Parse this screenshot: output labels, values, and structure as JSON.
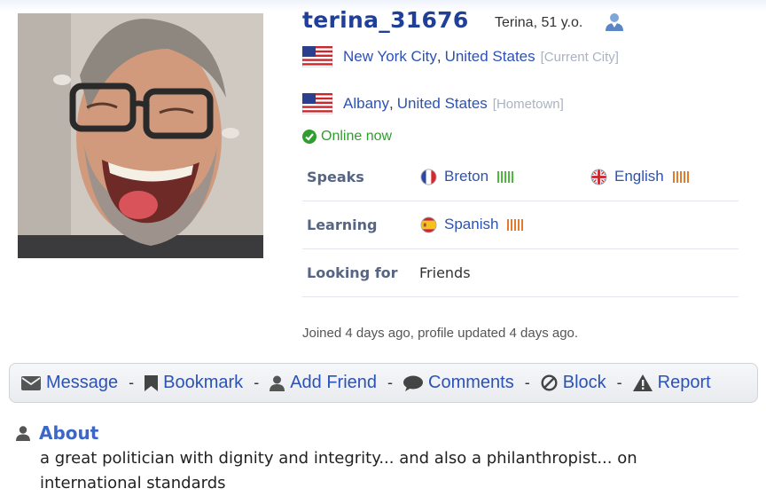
{
  "profile": {
    "username": "terina_31676",
    "age_text": "Terina, 51 y.o.",
    "current_city": "New York City",
    "current_country": "United States",
    "current_city_tag": "[Current City]",
    "hometown_city": "Albany",
    "hometown_country": "United States",
    "hometown_tag": "[Hometown]",
    "online_status": "Online now",
    "joined_text": "Joined 4 days ago, profile updated 4 days ago."
  },
  "languages": {
    "speaks_label": "Speaks",
    "speaks": [
      {
        "name": "Breton",
        "icon": "france-flag-icon",
        "level": 5,
        "bar_color": "#4cbb3c"
      },
      {
        "name": "English",
        "icon": "uk-flag-icon",
        "level": 5,
        "bar_color": "#e37a2c"
      }
    ],
    "learning_label": "Learning",
    "learning": [
      {
        "name": "Spanish",
        "icon": "spain-flag-icon",
        "level": 5,
        "bar_color": "#e37a2c"
      }
    ],
    "looking_for_label": "Looking for",
    "looking_for": "Friends"
  },
  "actions": {
    "message": "Message",
    "bookmark": "Bookmark",
    "add_friend": "Add Friend",
    "comments": "Comments",
    "block": "Block",
    "report": "Report",
    "separator": "-"
  },
  "about": {
    "heading": "About",
    "text": "a great politician with dignity and integrity... and also a philanthropist... on international standards"
  },
  "colors": {
    "link": "#2b52b6",
    "username": "#1f3f99",
    "online": "#2e9e2e",
    "label": "#566583"
  }
}
